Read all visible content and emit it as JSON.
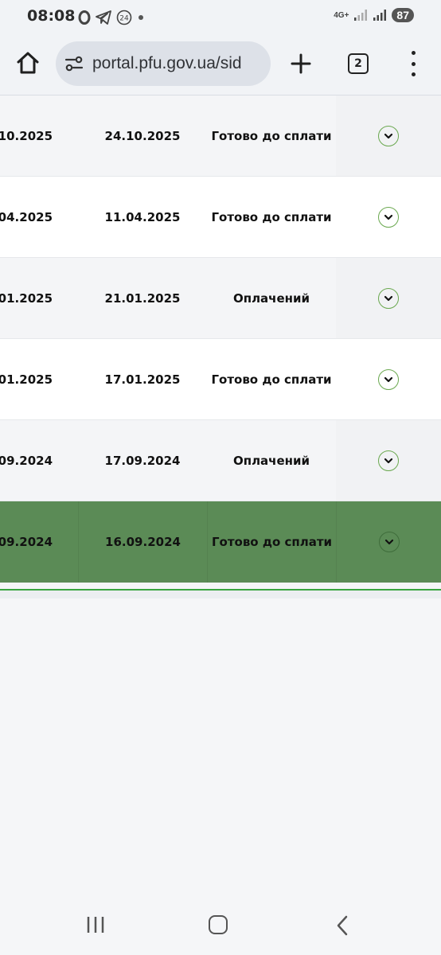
{
  "status_bar": {
    "time": "08:08",
    "icons": [
      "opera-icon",
      "telegram-icon",
      "news-24-icon",
      "dot-icon"
    ],
    "news_badge": "24",
    "network": "4G+",
    "battery": "87"
  },
  "browser": {
    "url": "portal.pfu.gov.ua/sid",
    "tab_count": "2"
  },
  "table": {
    "rows": [
      {
        "date1": ".10.2025",
        "date2": "24.10.2025",
        "status": "Готово до сплати",
        "variant": "alt"
      },
      {
        "date1": ".04.2025",
        "date2": "11.04.2025",
        "status": "Готово до сплати",
        "variant": "white"
      },
      {
        "date1": ".01.2025",
        "date2": "21.01.2025",
        "status": "Оплачений",
        "variant": "alt"
      },
      {
        "date1": ".01.2025",
        "date2": "17.01.2025",
        "status": "Готово до сплати",
        "variant": "white"
      },
      {
        "date1": ".09.2024",
        "date2": "17.09.2024",
        "status": "Оплачений",
        "variant": "alt"
      },
      {
        "date1": ".09.2024",
        "date2": "16.09.2024",
        "status": "Готово до сплати",
        "variant": "selected"
      }
    ]
  },
  "colors": {
    "selected_row": "#5b8b56",
    "accent_green": "#3aa540",
    "expand_border": "#6aa84f"
  }
}
